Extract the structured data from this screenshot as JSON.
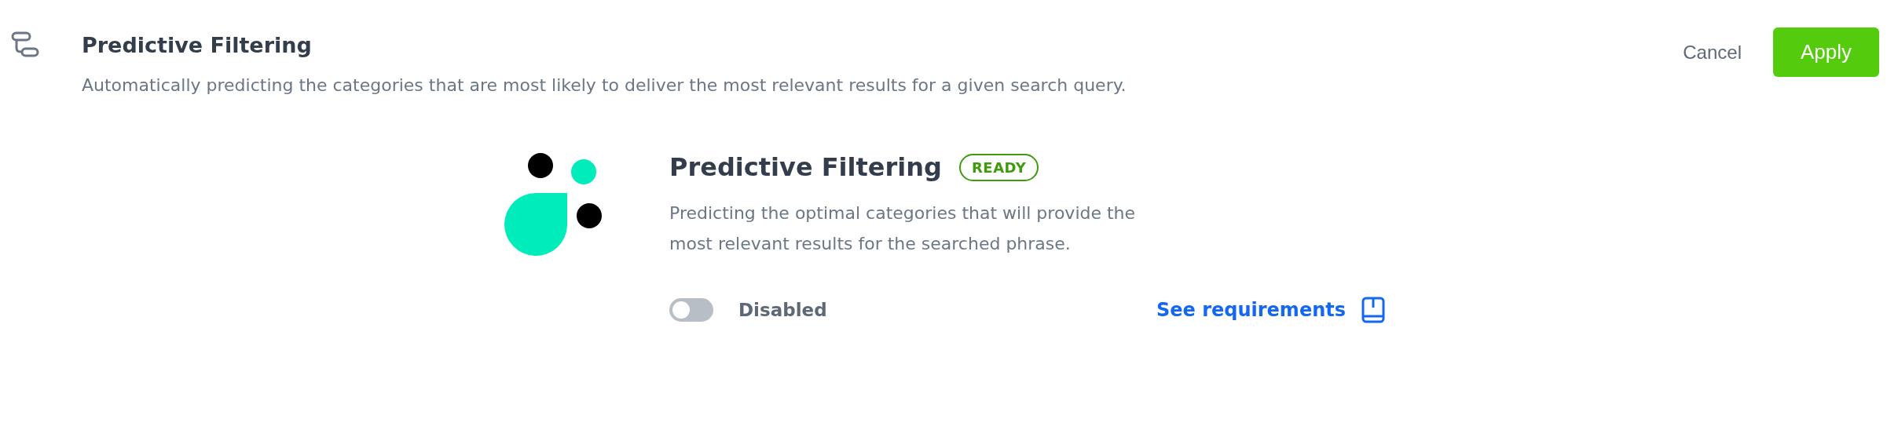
{
  "header": {
    "title": "Predictive Filtering",
    "description": "Automatically predicting the categories that are most likely to deliver the most relevant results for a given search query."
  },
  "actions": {
    "cancel": "Cancel",
    "apply": "Apply"
  },
  "feature": {
    "title": "Predictive Filtering",
    "badge": "READY",
    "description": "Predicting the optimal categories that will provide the most relevant results for the searched phrase.",
    "toggle": {
      "on": false,
      "label": "Disabled"
    },
    "link": "See requirements"
  }
}
